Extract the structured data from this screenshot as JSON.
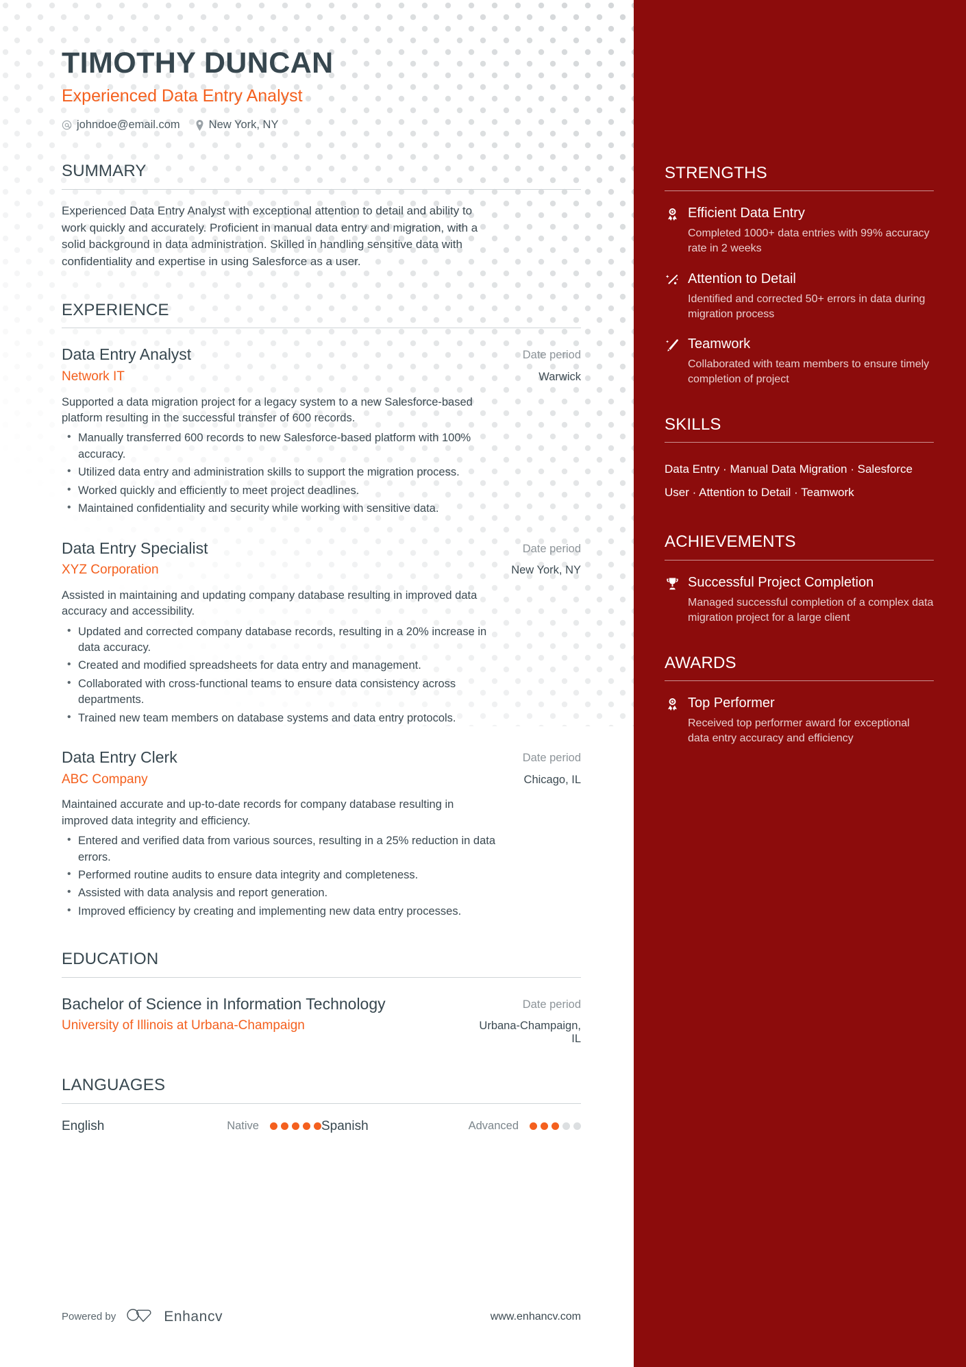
{
  "header": {
    "name": "TIMOTHY DUNCAN",
    "headline": "Experienced Data Entry Analyst",
    "email": "johndoe@email.com",
    "location": "New York, NY",
    "email_icon": "at-sign-icon",
    "location_icon": "map-pin-icon"
  },
  "summary": {
    "title": "SUMMARY",
    "text": "Experienced Data Entry Analyst with exceptional attention to detail and ability to work quickly and accurately. Proficient in manual data entry and migration, with a solid background in data administration. Skilled in handling sensitive data with confidentiality and expertise in using Salesforce as a user."
  },
  "experience": {
    "title": "EXPERIENCE",
    "entries": [
      {
        "role": "Data Entry Analyst",
        "date": "Date period",
        "company": "Network IT",
        "location": "Warwick",
        "description": "Supported a data migration project for a legacy system to a new Salesforce-based platform resulting in the successful transfer of 600 records.",
        "bullets": [
          "Manually transferred 600 records to new Salesforce-based platform with 100% accuracy.",
          "Utilized data entry and administration skills to support the migration process.",
          "Worked quickly and efficiently to meet project deadlines.",
          "Maintained confidentiality and security while working with sensitive data."
        ]
      },
      {
        "role": "Data Entry Specialist",
        "date": "Date period",
        "company": "XYZ Corporation",
        "location": "New York, NY",
        "description": "Assisted in maintaining and updating company database resulting in improved data accuracy and accessibility.",
        "bullets": [
          "Updated and corrected company database records, resulting in a 20% increase in data accuracy.",
          "Created and modified spreadsheets for data entry and management.",
          "Collaborated with cross-functional teams to ensure data consistency across departments.",
          "Trained new team members on database systems and data entry protocols."
        ]
      },
      {
        "role": "Data Entry Clerk",
        "date": "Date period",
        "company": "ABC Company",
        "location": "Chicago, IL",
        "description": "Maintained accurate and up-to-date records for company database resulting in improved data integrity and efficiency.",
        "bullets": [
          "Entered and verified data from various sources, resulting in a 25% reduction in data errors.",
          "Performed routine audits to ensure data integrity and completeness.",
          "Assisted with data analysis and report generation.",
          "Improved efficiency by creating and implementing new data entry processes."
        ]
      }
    ]
  },
  "education": {
    "title": "EDUCATION",
    "entries": [
      {
        "degree": "Bachelor of Science in Information Technology",
        "date": "Date period",
        "school": "University of Illinois at Urbana-Champaign",
        "location": "Urbana-Champaign, IL"
      }
    ]
  },
  "languages": {
    "title": "LANGUAGES",
    "items": [
      {
        "name": "English",
        "level": "Native",
        "filled": 5,
        "total": 5
      },
      {
        "name": "Spanish",
        "level": "Advanced",
        "filled": 3,
        "total": 5
      }
    ]
  },
  "footer": {
    "powered_by": "Powered by",
    "brand": "Enhancv",
    "url": "www.enhancv.com",
    "logo_icon": "enhancv-logo-icon"
  },
  "sidebar": {
    "strengths": {
      "title": "STRENGTHS",
      "items": [
        {
          "icon": "award-rosette-icon",
          "title": "Efficient Data Entry",
          "desc": "Completed 1000+ data entries with 99% accuracy rate in 2 weeks"
        },
        {
          "icon": "magic-sparkle-icon",
          "title": "Attention to Detail",
          "desc": "Identified and corrected 50+ errors in data during migration process"
        },
        {
          "icon": "magic-wand-icon",
          "title": "Teamwork",
          "desc": "Collaborated with team members to ensure timely completion of project"
        }
      ]
    },
    "skills": {
      "title": "SKILLS",
      "items": [
        "Data Entry",
        "Manual Data Migration",
        "Salesforce User",
        "Attention to Detail",
        "Teamwork"
      ],
      "separator": "·"
    },
    "achievements": {
      "title": "ACHIEVEMENTS",
      "items": [
        {
          "icon": "trophy-icon",
          "title": "Successful Project Completion",
          "desc": "Managed successful completion of a complex data migration project for a large client"
        }
      ]
    },
    "awards": {
      "title": "AWARDS",
      "items": [
        {
          "icon": "award-rosette-icon",
          "title": "Top Performer",
          "desc": "Received top performer award for exceptional data entry accuracy and efficiency"
        }
      ]
    }
  },
  "colors": {
    "accent_orange": "#f4601e",
    "sidebar_red": "#8c0c0c",
    "heading_dark": "#37474f"
  }
}
